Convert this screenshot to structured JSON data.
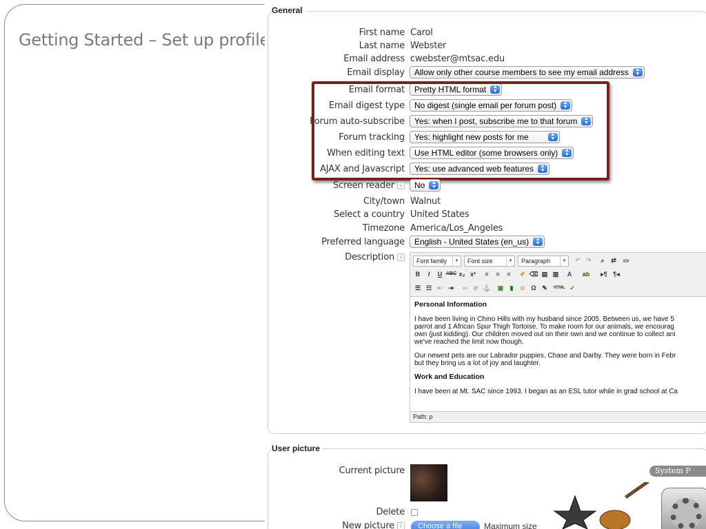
{
  "slide": {
    "title": "Getting Started – Set up profile"
  },
  "general": {
    "legend": "General",
    "fields": [
      {
        "label": "First name",
        "value": "Carol"
      },
      {
        "label": "Last name",
        "value": "Webster"
      },
      {
        "label": "Email address",
        "value": "cwebster@mtsac.edu"
      }
    ],
    "selects": [
      {
        "label": "Email display",
        "value": "Allow only other course members to see my email address"
      },
      {
        "label": "Email format",
        "value": "Pretty HTML format"
      },
      {
        "label": "Email digest type",
        "value": "No digest (single email per forum post)"
      },
      {
        "label": "Forum auto-subscribe",
        "value": "Yes: when I post, subscribe me to that forum"
      },
      {
        "label": "Forum tracking",
        "value": "Yes: highlight new posts for me"
      },
      {
        "label": "When editing text",
        "value": "Use HTML editor (some browsers only)"
      },
      {
        "label": "AJAX and Javascript",
        "value": "Yes: use advanced web features"
      },
      {
        "label": "Screen reader",
        "value": "No"
      }
    ],
    "location": [
      {
        "label": "City/town",
        "value": "Walnut"
      },
      {
        "label": "Select a country",
        "value": "United States"
      },
      {
        "label": "Timezone",
        "value": "America/Los_Angeles"
      }
    ],
    "language": {
      "label": "Preferred language",
      "value": "English - United States (en_us)"
    },
    "description": {
      "label": "Description",
      "toolbar": {
        "font_family": "Font family",
        "font_size": "Font size",
        "paragraph": "Paragraph"
      },
      "content": {
        "heading1": "Personal Information",
        "para1_line1": "I have been living in Chino Hills with my husband since 2005. Between us, we have 5",
        "para1_line2": "parrot and 1 African Spur Thigh Tortoise. To make room for our animals, we encourag",
        "para1_line3": "own (just kidding). Our children moved out on their own and we continue to collect ani",
        "para1_line4": "we've reached the limit now though.",
        "para2_line1": "Our newest pets are our Labrador puppies, Chase and Darby. They were born in Febr",
        "para2_line2": "but they bring us a lot of joy and laughter.",
        "heading2": "Work and Education",
        "para3_line1": "I have been at Mt. SAC since 1993. I began as an ESL tutor while in grad school at Ca"
      },
      "path": "Path: p"
    }
  },
  "user_picture": {
    "legend": "User picture",
    "current_label": "Current picture",
    "delete_label": "Delete",
    "new_label": "New picture",
    "choose_button": "Choose a file",
    "max_size": "Maximum size",
    "system_badge": "System P"
  }
}
